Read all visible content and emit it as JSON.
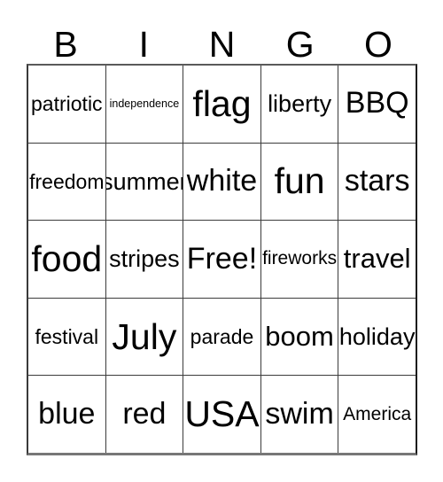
{
  "card": {
    "title": "BINGO",
    "header_letters": [
      "B",
      "I",
      "N",
      "G",
      "O"
    ],
    "colors": {
      "background": "#ffffff",
      "text": "#000000",
      "grid_line": "#3c3c3c",
      "outer_border": "#1a1a1a"
    },
    "grid_size": "5x5",
    "rows": [
      {
        "cells": [
          {
            "label": "patriotic",
            "size": "ml"
          },
          {
            "label": "independence",
            "size": "xs"
          },
          {
            "label": "flag",
            "size": "huge"
          },
          {
            "label": "liberty",
            "size": "l"
          },
          {
            "label": "BBQ",
            "size": "xxl"
          }
        ]
      },
      {
        "cells": [
          {
            "label": "freedom",
            "size": "ml"
          },
          {
            "label": "summer",
            "size": "l"
          },
          {
            "label": "white",
            "size": "xxl"
          },
          {
            "label": "fun",
            "size": "huge"
          },
          {
            "label": "stars",
            "size": "xxl"
          }
        ]
      },
      {
        "cells": [
          {
            "label": "food",
            "size": "huge"
          },
          {
            "label": "stripes",
            "size": "l"
          },
          {
            "label": "Free!",
            "size": "xxl"
          },
          {
            "label": "fireworks",
            "size": "m"
          },
          {
            "label": "travel",
            "size": "xl"
          }
        ]
      },
      {
        "cells": [
          {
            "label": "festival",
            "size": "ml"
          },
          {
            "label": "July",
            "size": "huge"
          },
          {
            "label": "parade",
            "size": "ml"
          },
          {
            "label": "boom",
            "size": "xl"
          },
          {
            "label": "holiday",
            "size": "l"
          }
        ]
      },
      {
        "cells": [
          {
            "label": "blue",
            "size": "xxl"
          },
          {
            "label": "red",
            "size": "xxl"
          },
          {
            "label": "USA",
            "size": "huge"
          },
          {
            "label": "swim",
            "size": "xxl"
          },
          {
            "label": "America",
            "size": "m"
          }
        ]
      }
    ]
  }
}
